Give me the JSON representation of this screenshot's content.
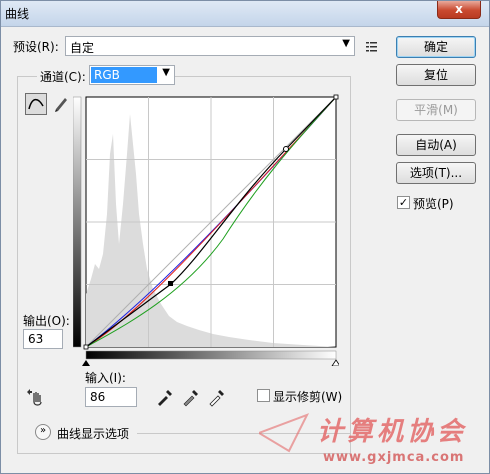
{
  "window": {
    "title": "曲线",
    "close_label": "x"
  },
  "preset": {
    "label": "预设(R):",
    "value": "自定"
  },
  "channel": {
    "label": "通道(C):",
    "value": "RGB"
  },
  "buttons": {
    "ok": "确定",
    "reset": "复位",
    "smooth": "平滑(M)",
    "auto": "自动(A)",
    "options": "选项(T)..."
  },
  "preview": {
    "label": "预览(P)",
    "checked": true
  },
  "output": {
    "label": "输出(O):",
    "value": "63"
  },
  "input": {
    "label": "输入(I):",
    "value": "86"
  },
  "show_clipping": {
    "label": "显示修剪(W)",
    "checked": false
  },
  "curve_options": {
    "label": "曲线显示选项"
  },
  "watermark": {
    "cn": "计算机协会",
    "url": "www.gxjmca.com"
  },
  "curve_points": [
    [
      0,
      0
    ],
    [
      86,
      63
    ],
    [
      200,
      218
    ],
    [
      255,
      255
    ]
  ],
  "colors": {
    "grid_line": "#c8c8c8",
    "histogram": "#dcdcdc",
    "curve_rgb": "#000000",
    "curve_red": "#e02020",
    "curve_green": "#20a020",
    "curve_blue": "#2020e0",
    "accent_select": "#3399ff"
  }
}
